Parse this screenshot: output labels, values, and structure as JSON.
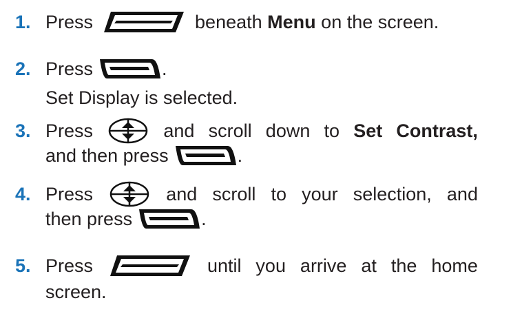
{
  "steps": [
    {
      "number": "1.",
      "press": "Press",
      "icon": "left-softkey-icon",
      "after": "beneath",
      "bold": "Menu",
      "tail": "on the screen."
    },
    {
      "number": "2.",
      "press": "Press",
      "icon": "right-softkey-icon",
      "tail": ".",
      "note": "Set Display is selected."
    },
    {
      "number": "3.",
      "press": "Press",
      "icon": "navigation-key-icon",
      "w1": "and",
      "w2": "scroll",
      "w3": "down",
      "w4": "to",
      "bold1": "Set",
      "bold2": "Contrast,",
      "line2_text": "and then press",
      "line2_icon": "right-softkey-icon",
      "line2_tail": "."
    },
    {
      "number": "4.",
      "press": "Press",
      "icon": "navigation-key-icon",
      "w1": "and",
      "w2": "scroll",
      "w3": "to",
      "w4": "your",
      "w5": "selection,",
      "w6": "and",
      "line2_text": "then press",
      "line2_icon": "right-softkey-icon",
      "line2_tail": "."
    },
    {
      "number": "5.",
      "press": "Press",
      "icon": "left-softkey-icon",
      "w1": "until",
      "w2": "you",
      "w3": "arrive",
      "w4": "at",
      "w5": "the",
      "w6": "home",
      "line2_text": "screen."
    }
  ],
  "colors": {
    "step_number": "#1a73b8",
    "text": "#231f20",
    "icon": "#111111"
  }
}
